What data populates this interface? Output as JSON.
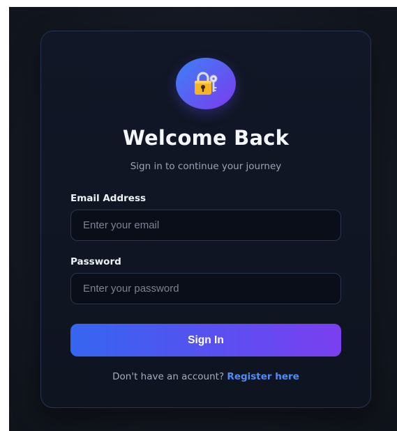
{
  "login": {
    "logo_icon": "lock-with-key-icon",
    "title": "Welcome Back",
    "subtitle": "Sign in to continue your journey",
    "email": {
      "label": "Email Address",
      "placeholder": "Enter your email",
      "value": ""
    },
    "password": {
      "label": "Password",
      "placeholder": "Enter your password",
      "value": ""
    },
    "submit_label": "Sign In",
    "footer_text": "Don't have an account?",
    "register_link": "Register here"
  },
  "colors": {
    "accent_start": "#3b82f6",
    "accent_end": "#7c3aed",
    "link": "#4f8df5",
    "card_bg": "#111726"
  }
}
